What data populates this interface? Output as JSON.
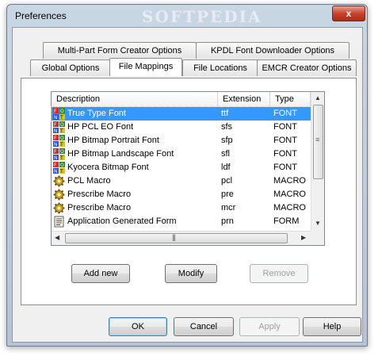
{
  "window": {
    "title": "Preferences",
    "watermark": "SOFTPEDIA",
    "close_glyph": "x"
  },
  "tabs_row1": [
    {
      "label": "Multi-Part Form Creator Options"
    },
    {
      "label": "KPDL Font Downloader Options"
    }
  ],
  "tabs_row2": [
    {
      "label": "Global Options"
    },
    {
      "label": "File Mappings",
      "active": true
    },
    {
      "label": "File Locations"
    },
    {
      "label": "EMCR Creator Options"
    }
  ],
  "list": {
    "columns": [
      "Description",
      "Extension",
      "Type"
    ],
    "rows": [
      {
        "description": "True Type Font",
        "extension": "ttf",
        "type": "FONT",
        "icon": "font-icon",
        "selected": true
      },
      {
        "description": "HP PCL EO Font",
        "extension": "sfs",
        "type": "FONT",
        "icon": "font-icon"
      },
      {
        "description": "HP Bitmap Portrait Font",
        "extension": "sfp",
        "type": "FONT",
        "icon": "font-icon"
      },
      {
        "description": "HP Bitmap Landscape Font",
        "extension": "sfl",
        "type": "FONT",
        "icon": "font-icon"
      },
      {
        "description": "Kyocera Bitmap Font",
        "extension": "ldf",
        "type": "FONT",
        "icon": "font-icon"
      },
      {
        "description": "PCL Macro",
        "extension": "pcl",
        "type": "MACRO",
        "icon": "gear-icon"
      },
      {
        "description": "Prescribe Macro",
        "extension": "pre",
        "type": "MACRO",
        "icon": "gear-icon"
      },
      {
        "description": "Prescribe Macro",
        "extension": "mcr",
        "type": "MACRO",
        "icon": "gear-icon"
      },
      {
        "description": "Application Generated Form",
        "extension": "prn",
        "type": "FORM",
        "icon": "form-icon"
      }
    ]
  },
  "list_buttons": {
    "add_new": "Add new",
    "modify": "Modify",
    "remove": "Remove"
  },
  "dialog_buttons": {
    "ok": "OK",
    "cancel": "Cancel",
    "apply": "Apply",
    "help": "Help"
  },
  "colors": {
    "selection": "#3399ff",
    "close_button": "#c8432b"
  }
}
